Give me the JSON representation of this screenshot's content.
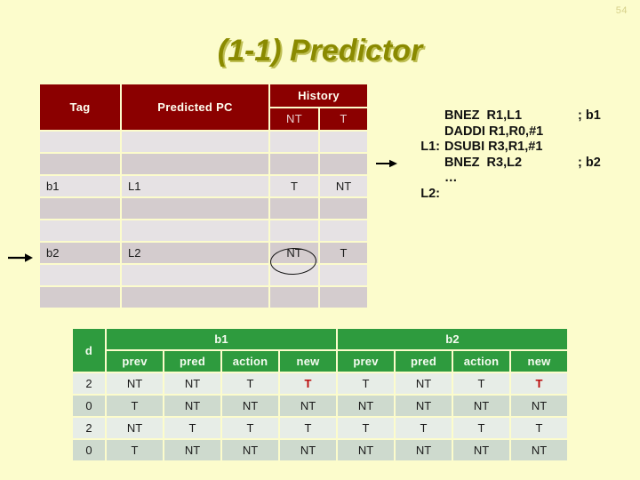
{
  "slide": {
    "number": "54",
    "title": "(1-1) Predictor",
    "background_color": "#FCFCCC",
    "title_color": "#8A8A00"
  },
  "btb_table": {
    "accent_color": "#8B0000",
    "headers": {
      "tag": "Tag",
      "predicted_pc": "Predicted PC",
      "history": "History",
      "history_sub": [
        "NT",
        "T"
      ]
    },
    "rows": [
      {
        "tag": "",
        "pc": "",
        "nt": "",
        "t": ""
      },
      {
        "tag": "",
        "pc": "",
        "nt": "",
        "t": ""
      },
      {
        "tag": "b1",
        "pc": "L1",
        "nt": "T",
        "t": "NT"
      },
      {
        "tag": "",
        "pc": "",
        "nt": "",
        "t": ""
      },
      {
        "tag": "",
        "pc": "",
        "nt": "",
        "t": ""
      },
      {
        "tag": "b2",
        "pc": "L2",
        "nt": "NT",
        "t": "T"
      },
      {
        "tag": "",
        "pc": "",
        "nt": "",
        "t": ""
      },
      {
        "tag": "",
        "pc": "",
        "nt": "",
        "t": ""
      }
    ],
    "annotation": {
      "circled_cell": "NT",
      "circled_row_tag": "b2"
    }
  },
  "code_listing": {
    "lines": [
      {
        "label": "",
        "instruction": "BNEZ  R1,L1",
        "comment": "; b1",
        "marker": ""
      },
      {
        "label": "",
        "instruction": "DADDI R1,R0,#1",
        "comment": "",
        "marker": ""
      },
      {
        "label": "L1:",
        "instruction": "DSUBI R3,R1,#1",
        "comment": "",
        "marker": ""
      },
      {
        "label": "",
        "instruction": "BNEZ  R3,L2",
        "comment": "; b2",
        "marker": "arrow-right-icon"
      },
      {
        "label": "",
        "instruction": "…",
        "comment": "",
        "marker": ""
      },
      {
        "label": "L2:",
        "instruction": "",
        "comment": "",
        "marker": ""
      }
    ]
  },
  "trace_table": {
    "accent_color": "#2E9B3E",
    "highlight_color": "#BB0A0A",
    "group_headers": [
      "b1",
      "b2"
    ],
    "d_header": "d",
    "sub_headers": [
      "prev",
      "pred",
      "action",
      "new"
    ],
    "rows": [
      {
        "d": "2",
        "b1": [
          "NT",
          "NT",
          "T",
          "T"
        ],
        "b1_hl": [
          false,
          false,
          false,
          true
        ],
        "b2": [
          "T",
          "NT",
          "T",
          "T"
        ],
        "b2_hl": [
          false,
          false,
          false,
          true
        ]
      },
      {
        "d": "0",
        "b1": [
          "T",
          "NT",
          "NT",
          "NT"
        ],
        "b1_hl": [
          false,
          false,
          false,
          false
        ],
        "b2": [
          "NT",
          "NT",
          "NT",
          "NT"
        ],
        "b2_hl": [
          false,
          false,
          false,
          false
        ]
      },
      {
        "d": "2",
        "b1": [
          "NT",
          "T",
          "T",
          "T"
        ],
        "b1_hl": [
          false,
          false,
          false,
          false
        ],
        "b2": [
          "T",
          "T",
          "T",
          "T"
        ],
        "b2_hl": [
          false,
          false,
          false,
          false
        ]
      },
      {
        "d": "0",
        "b1": [
          "T",
          "NT",
          "NT",
          "NT"
        ],
        "b1_hl": [
          false,
          false,
          false,
          false
        ],
        "b2": [
          "NT",
          "NT",
          "NT",
          "NT"
        ],
        "b2_hl": [
          false,
          false,
          false,
          false
        ]
      }
    ]
  }
}
